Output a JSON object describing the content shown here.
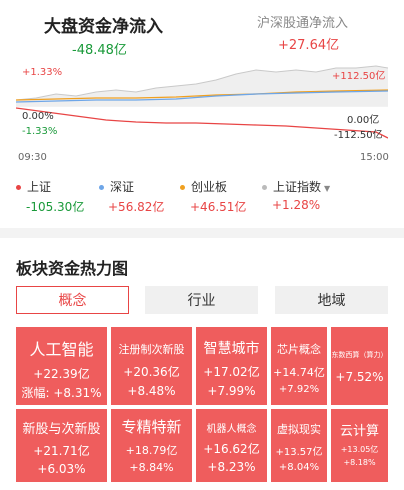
{
  "header": {
    "main_title": "大盘资金净流入",
    "main_value": "-48.48亿",
    "hk_title": "沪深股通净流入",
    "hk_value": "+27.64亿"
  },
  "chart": {
    "left_top": "+1.33%",
    "left_mid": "0.00%",
    "left_bottom": "-1.33%",
    "right_top": "+112.50亿",
    "right_mid": "0.00亿",
    "right_bottom": "-112.50亿",
    "time_start": "09:30",
    "time_end": "15:00"
  },
  "legend": [
    {
      "name": "上证",
      "value": "-105.30亿",
      "color": "#e84545"
    },
    {
      "name": "深证",
      "value": "+56.82亿",
      "color": "#6ea6e8"
    },
    {
      "name": "创业板",
      "value": "+46.51亿",
      "color": "#f0a020"
    },
    {
      "name": "上证指数",
      "value": "+1.28%",
      "color": "#bbbbbb"
    }
  ],
  "section": {
    "title": "板块资金热力图",
    "tabs": [
      "概念",
      "行业",
      "地域"
    ]
  },
  "tiles": [
    {
      "name": "人工智能",
      "value": "+22.39亿",
      "pct": "涨幅: +8.31%"
    },
    {
      "name": "注册制次新股",
      "value": "+20.36亿",
      "pct": "+8.48%"
    },
    {
      "name": "智慧城市",
      "value": "+17.02亿",
      "pct": "+7.99%"
    },
    {
      "name": "芯片概念",
      "value": "+14.74亿",
      "pct": "+7.92%"
    },
    {
      "name": "东数西算（算力）",
      "value": "+7.52%",
      "pct": ""
    },
    {
      "name": "新股与次新股",
      "value": "+21.71亿",
      "pct": "+6.03%"
    },
    {
      "name": "专精特新",
      "value": "+18.79亿",
      "pct": "+8.84%"
    },
    {
      "name": "机器人概念",
      "value": "+16.62亿",
      "pct": "+8.23%"
    },
    {
      "name": "虚拟现实",
      "value": "+13.57亿",
      "pct": "+8.04%"
    },
    {
      "name": "云计算",
      "value": "+13.05亿",
      "pct": "+8.18%"
    }
  ]
}
